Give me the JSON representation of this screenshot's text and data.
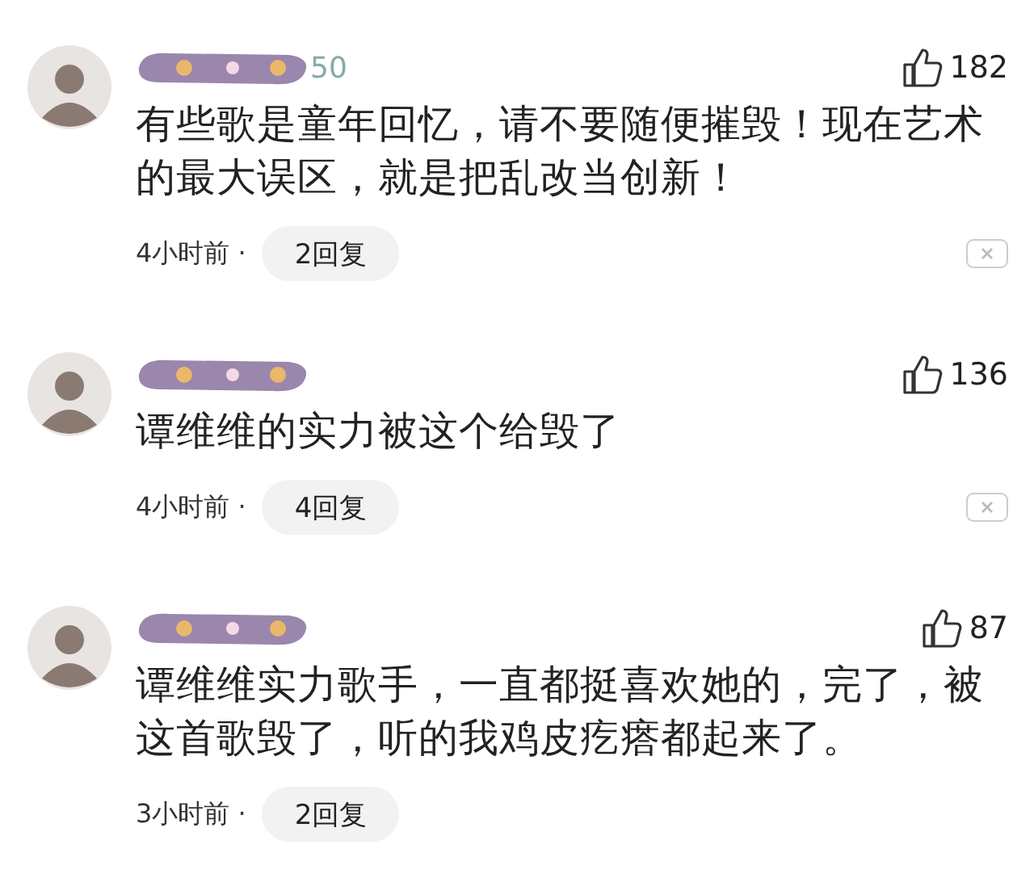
{
  "comments": [
    {
      "username_visible": "50",
      "likes": "182",
      "text": "有些歌是童年回忆，请不要随便摧毁！现在艺术的最大误区，就是把乱改当创新！",
      "time": "4小时前 ·",
      "replies": "2回复",
      "dismissable": true
    },
    {
      "likes": "136",
      "text": "谭维维的实力被这个给毁了",
      "time": "4小时前 ·",
      "replies": "4回复",
      "dismissable": true
    },
    {
      "likes": "87",
      "text": "谭维维实力歌手，一直都挺喜欢她的，完了，被这首歌毁了，听的我鸡皮疙瘩都起来了。",
      "time": "3小时前 ·",
      "replies": "2回复",
      "dismissable": false
    }
  ]
}
